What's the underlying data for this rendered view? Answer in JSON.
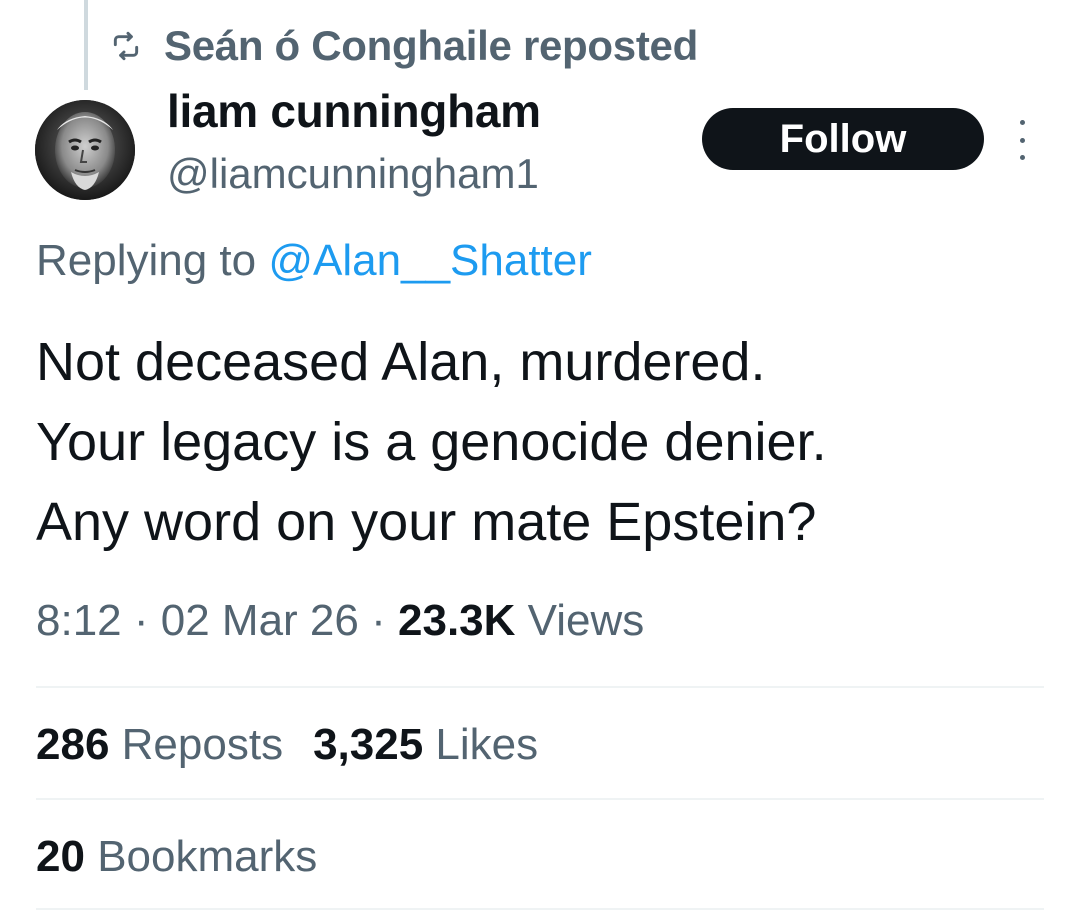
{
  "repost_banner": {
    "text": "Seán ó Conghaile reposted",
    "icon": "repost-icon"
  },
  "author": {
    "name": "liam cunningham",
    "handle": "@liamcunningham1"
  },
  "follow_label": "Follow",
  "replying": {
    "prefix": "Replying to",
    "mention": "@Alan__Shatter"
  },
  "tweet": {
    "lines": [
      "Not deceased Alan, murdered.",
      "Your legacy is a genocide denier.",
      "Any word on your mate Epstein?"
    ]
  },
  "meta": {
    "time": "8:12",
    "date": "02 Mar 26",
    "views_count": "23.3K",
    "views_label": "Views",
    "separator": "·"
  },
  "stats": {
    "reposts_count": "286",
    "reposts_label": "Reposts",
    "likes_count": "3,325",
    "likes_label": "Likes",
    "bookmarks_count": "20",
    "bookmarks_label": "Bookmarks"
  },
  "colors": {
    "primary_text": "#0f1419",
    "secondary_text": "#536471",
    "link": "#1d9bf0",
    "divider": "#eff3f4",
    "button_bg": "#0f1419"
  }
}
